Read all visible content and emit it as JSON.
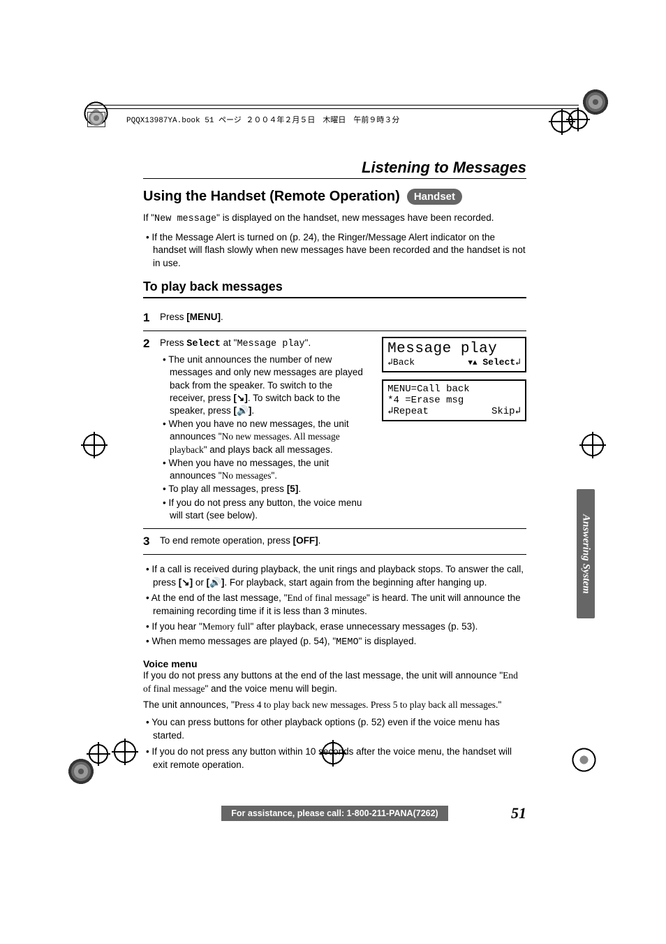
{
  "book_info": "PQQX13987YA.book  51 ページ  ２００４年２月５日　木曜日　午前９時３分",
  "chapter_title": "Listening to Messages",
  "section_title": "Using the Handset (Remote Operation)",
  "badge": "Handset",
  "intro_prefix": "If \"",
  "intro_mono": "New message",
  "intro_suffix": "\" is displayed on the handset, new messages have been recorded.",
  "alert_note": "If the Message Alert is turned on (p. 24), the Ringer/Message Alert indicator on the handset will flash slowly when new messages have been recorded and the handset is not in use.",
  "h2": "To play back messages",
  "steps": {
    "s1": {
      "num": "1",
      "pre": "Press ",
      "bold": "[MENU]",
      "post": "."
    },
    "s2": {
      "num": "2",
      "pre": "Press ",
      "bold1": "Select",
      "mid": " at \"",
      "mono": "Message play",
      "post": "\".",
      "b1_a": "The unit announces the number of new messages and only new messages are played back from the speaker. To switch to the receiver, press ",
      "b1_b": ". To switch back to the speaker, press ",
      "b1_c": ".",
      "b2_a": "When you have no new messages, the unit announces \"",
      "b2_serif": "No new messages. All message playback",
      "b2_b": "\" and plays back all messages.",
      "b3_a": "When you have no messages, the unit announces \"",
      "b3_serif": "No messages",
      "b3_b": "\".",
      "b4_a": "To play all messages, press ",
      "b4_bold": "[5]",
      "b4_b": ".",
      "b5": "If you do not press any button, the voice menu will start (see below)."
    },
    "s3": {
      "num": "3",
      "pre": "To end remote operation, press ",
      "bold": "[OFF]",
      "post": "."
    }
  },
  "lcd1": {
    "title": "Message play",
    "back": "Back",
    "select": "Select"
  },
  "lcd2": {
    "l1": "MENU=Call back",
    "l2": " *4 =Erase msg",
    "l3a": "Repeat",
    "l3b": "Skip"
  },
  "after": {
    "a1_a": "If a call is received during playback, the unit rings and playback stops. To answer the call, press ",
    "a1_b": " or ",
    "a1_c": ". For playback, start again from the beginning after hanging up.",
    "a2_a": "At the end of the last message, \"",
    "a2_serif": "End of final message",
    "a2_b": "\" is heard. The unit will announce the remaining recording time if it is less than 3 minutes.",
    "a3_a": "If you hear \"",
    "a3_serif": "Memory full",
    "a3_b": "\" after playback, erase unnecessary messages (p. 53).",
    "a4_a": "When memo messages are played (p. 54), \"",
    "a4_mono": "MEMO",
    "a4_b": "\" is displayed."
  },
  "vm": {
    "head": "Voice menu",
    "p1_a": "If you do not press any buttons at the end of the last message, the unit will announce \"",
    "p1_serif": "End of final message",
    "p1_b": "\" and the voice menu will begin.",
    "p2_a": "The unit announces, \"",
    "p2_serif": "Press 4 to play back new messages. Press 5 to play back all messages.",
    "p2_b": "\"",
    "b1": "You can press buttons for other playback options (p. 52) even if the voice menu has started.",
    "b2": "If you do not press any button within 10 seconds after the voice menu, the handset will exit remote operation."
  },
  "side_tab": "Answering System",
  "footer": "For assistance, please call: 1-800-211-PANA(7262)",
  "page_num": "51",
  "icons": {
    "talk_key": "[↘]",
    "speaker_key": "[🔊]"
  }
}
